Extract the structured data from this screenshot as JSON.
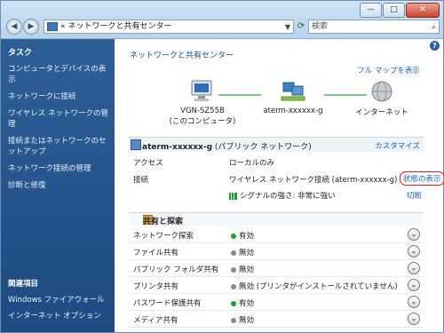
{
  "window": {
    "address": "ネットワークと共有センター",
    "address_prefix": "«",
    "search_placeholder": "検索",
    "controls": {
      "minimize": "—",
      "maximize": "□",
      "close": "✕"
    }
  },
  "sidebar": {
    "heading": "タスク",
    "items": [
      "コンピュータとデバイスの表示",
      "ネットワークに接続",
      "ワイヤレス ネットワークの管理",
      "接続またはネットワークのセットアップ",
      "ネットワーク接続の管理",
      "診断と修復"
    ],
    "related_heading": "関連項目",
    "related": [
      "Windows ファイアウォール",
      "インターネット オプション"
    ]
  },
  "main": {
    "title": "ネットワークと共有センター",
    "full_map": "フル マップを表示",
    "map_nodes": [
      {
        "label_line1": "VGN-SZ55B",
        "label_line2": "(このコンピュータ)"
      },
      {
        "label_line1": "aterm-xxxxxx-g",
        "label_line2": ""
      },
      {
        "label_line1": "インターネット",
        "label_line2": ""
      }
    ],
    "network": {
      "name": "aterm-xxxxxx-g",
      "type": " (パブリック ネットワーク)",
      "customize": "カスタマイズ",
      "access_label": "アクセス",
      "access_value": "ローカルのみ",
      "connection_label": "接続",
      "connection_value": "ワイヤレス ネットワーク接続 (aterm-xxxxxx-g)",
      "view_status": "状態の表示",
      "signal": "シグナルの強さ: 非常に強い",
      "disconnect": "切断"
    },
    "sharing": {
      "heading": "共有と探索",
      "rows": [
        {
          "label": "ネットワーク探索",
          "value": "有効",
          "status": "on"
        },
        {
          "label": "ファイル共有",
          "value": "無効",
          "status": "off"
        },
        {
          "label": "パブリック フォルダ共有",
          "value": "無効",
          "status": "off"
        },
        {
          "label": "プリンタ共有",
          "value": "無効 (プリンタがインストールされていません)",
          "status": "off"
        },
        {
          "label": "パスワード保護共有",
          "value": "有効",
          "status": "on"
        },
        {
          "label": "メディア共有",
          "value": "無効",
          "status": "off"
        }
      ]
    }
  },
  "colors": {
    "on": "#22a02a",
    "off": "#8a8a8a",
    "accent": "#1f5fbf"
  },
  "icons": {
    "expand": "⌄"
  }
}
